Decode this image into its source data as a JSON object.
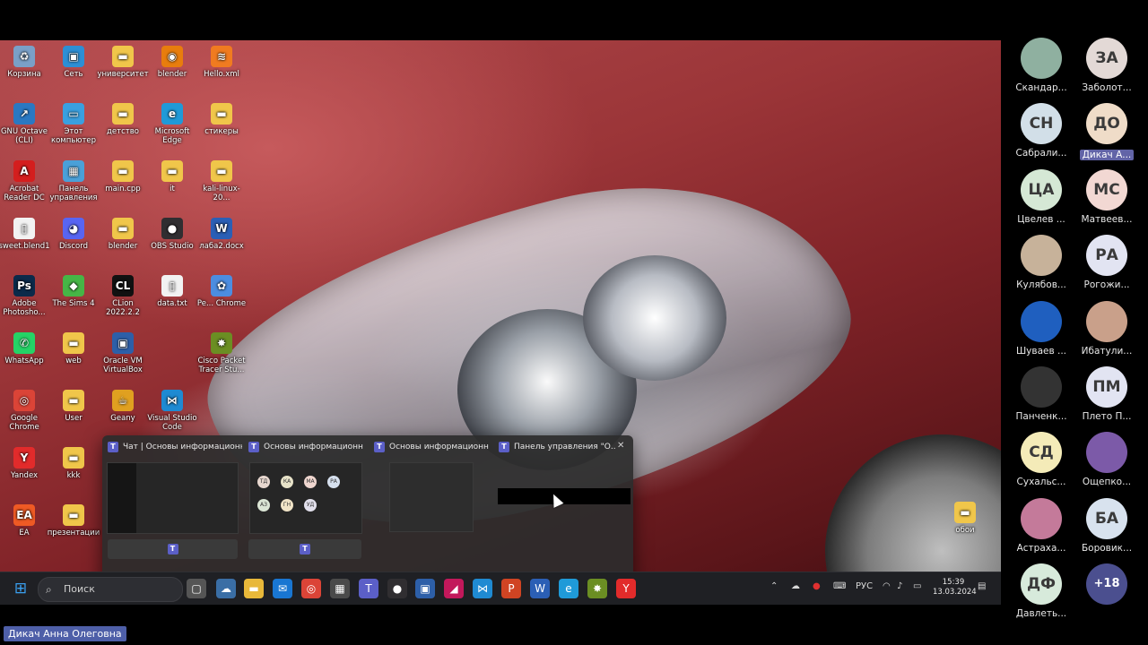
{
  "desktop": {
    "icons": [
      {
        "label": "Корзина",
        "glyph": "♻",
        "color": "#7aa0c8"
      },
      {
        "label": "Сеть",
        "glyph": "▣",
        "color": "#2d8fd5"
      },
      {
        "label": "университет",
        "glyph": "▬",
        "color": "#f0c64a"
      },
      {
        "label": "blender",
        "glyph": "◉",
        "color": "#e87d0d"
      },
      {
        "label": "Hello.xml",
        "glyph": "≋",
        "color": "#f07b20"
      },
      {
        "label": "GNU Octave\n(CLI)",
        "glyph": "↗",
        "color": "#2a78c2"
      },
      {
        "label": "Этот\nкомпьютер",
        "glyph": "▭",
        "color": "#3aa0e0"
      },
      {
        "label": "детство",
        "glyph": "▬",
        "color": "#f0c64a"
      },
      {
        "label": "Microsoft\nEdge",
        "glyph": "e",
        "color": "#1f9ad8"
      },
      {
        "label": "стикеры",
        "glyph": "▬",
        "color": "#f0c64a"
      },
      {
        "label": "Acrobat\nReader DC",
        "glyph": "A",
        "color": "#d41e1e"
      },
      {
        "label": "Панель\nуправления",
        "glyph": "▦",
        "color": "#4aa0d8"
      },
      {
        "label": "main.cpp",
        "glyph": "▬",
        "color": "#f0c64a"
      },
      {
        "label": "it",
        "glyph": "▬",
        "color": "#f0c64a"
      },
      {
        "label": "kali-linux-20...",
        "glyph": "▬",
        "color": "#f0c64a"
      },
      {
        "label": "sweet.blend1",
        "glyph": "▯",
        "color": "#f2f2f2"
      },
      {
        "label": "Discord",
        "glyph": "◕",
        "color": "#5865f2"
      },
      {
        "label": "blender",
        "glyph": "▬",
        "color": "#f0c64a"
      },
      {
        "label": "OBS Studio",
        "glyph": "●",
        "color": "#302e31"
      },
      {
        "label": "лаба2.docx",
        "glyph": "W",
        "color": "#2b5fb5"
      },
      {
        "label": "Adobe\nPhotosho...",
        "glyph": "Ps",
        "color": "#0b2a4a"
      },
      {
        "label": "The Sims 4",
        "glyph": "◆",
        "color": "#46b546"
      },
      {
        "label": "CLion\n2022.2.2",
        "glyph": "CL",
        "color": "#111111"
      },
      {
        "label": "data.txt",
        "glyph": "▯",
        "color": "#f2f2f2"
      },
      {
        "label": "Pe... Chrome",
        "glyph": "✿",
        "color": "#4c8de0"
      },
      {
        "label": "WhatsApp",
        "glyph": "✆",
        "color": "#25d366"
      },
      {
        "label": "web",
        "glyph": "▬",
        "color": "#f0c64a"
      },
      {
        "label": "Oracle VM\nVirtualBox",
        "glyph": "▣",
        "color": "#2d5fa8"
      },
      {
        "label": "Cisco Packet\nTracer Stu...",
        "glyph": "✸",
        "color": "#6b8e23"
      },
      {
        "label": "Google\nChrome",
        "glyph": "◎",
        "color": "#db4437"
      },
      {
        "label": "User",
        "glyph": "▬",
        "color": "#f0c64a"
      },
      {
        "label": "Geany",
        "glyph": "☕",
        "color": "#e0a020"
      },
      {
        "label": "Visual Studio\nCode",
        "glyph": "⋈",
        "color": "#1f8ad2"
      },
      {
        "label": "Yandex",
        "glyph": "Y",
        "color": "#e22b2b"
      },
      {
        "label": "kkk",
        "glyph": "▬",
        "color": "#f0c64a"
      },
      {
        "label": "EA",
        "glyph": "EA",
        "color": "#ef5a24"
      },
      {
        "label": "презентации",
        "glyph": "▬",
        "color": "#f0c64a"
      },
      {
        "label": "обои",
        "glyph": "▬",
        "color": "#f0c64a"
      }
    ]
  },
  "switcher": {
    "windows": [
      {
        "title": "Чат | Основы информационно..."
      },
      {
        "title": "Основы информационно..."
      },
      {
        "title": "Основы информационно..."
      },
      {
        "title": "Панель управления \"О..."
      }
    ],
    "close_glyph": "✕",
    "thumb_avatars": [
      "ТД",
      "КА",
      "МА",
      "РА",
      "АЗ",
      "ГН",
      "УД"
    ]
  },
  "taskbar": {
    "search_label": "Поиск",
    "language": "РУС",
    "time": "15:39",
    "date": "13.03.2024",
    "apps": [
      {
        "name": "task-view-icon",
        "glyph": "▢",
        "color": "#555"
      },
      {
        "name": "widgets-icon",
        "glyph": "☁",
        "color": "#3a6ea5"
      },
      {
        "name": "file-explorer-icon",
        "glyph": "▬",
        "color": "#e8b83a"
      },
      {
        "name": "mail-icon",
        "glyph": "✉",
        "color": "#1976d2"
      },
      {
        "name": "chrome-icon",
        "glyph": "◎",
        "color": "#db4437"
      },
      {
        "name": "calculator-icon",
        "glyph": "▦",
        "color": "#4a4a4a"
      },
      {
        "name": "teams-icon",
        "glyph": "T",
        "color": "#5b5fc7"
      },
      {
        "name": "obs-icon",
        "glyph": "●",
        "color": "#302e31"
      },
      {
        "name": "virtualbox-icon",
        "glyph": "▣",
        "color": "#2d5fa8"
      },
      {
        "name": "jetbrains-icon",
        "glyph": "◢",
        "color": "#c2185b"
      },
      {
        "name": "vscode-icon",
        "glyph": "⋈",
        "color": "#1f8ad2"
      },
      {
        "name": "powerpoint-icon",
        "glyph": "P",
        "color": "#d04423"
      },
      {
        "name": "word-icon",
        "glyph": "W",
        "color": "#2b5fb5"
      },
      {
        "name": "edge-icon",
        "glyph": "e",
        "color": "#1f9ad8"
      },
      {
        "name": "packet-tracer-icon",
        "glyph": "✸",
        "color": "#6b8e23"
      },
      {
        "name": "yandex-icon",
        "glyph": "Y",
        "color": "#e22b2b"
      }
    ]
  },
  "participants": [
    {
      "name": "Скандар...",
      "initials": "",
      "bg": "#8fb0a0"
    },
    {
      "name": "Заболот...",
      "initials": "ЗА",
      "bg": "#e3d9d6"
    },
    {
      "name": "Сабрали...",
      "initials": "СН",
      "bg": "#d2dfe8"
    },
    {
      "name": "Дикач А...",
      "initials": "ДО",
      "bg": "#efdcc8",
      "highlight": true
    },
    {
      "name": "Цвелев ...",
      "initials": "ЦА",
      "bg": "#d5e8d5"
    },
    {
      "name": "Матвеев...",
      "initials": "МС",
      "bg": "#f2d8d3"
    },
    {
      "name": "Кулябов...",
      "initials": "",
      "bg": "#c7b29a"
    },
    {
      "name": "Рогожи...",
      "initials": "РА",
      "bg": "#e2e4f2"
    },
    {
      "name": "Шуваев ...",
      "initials": "",
      "bg": "#1f5fbf"
    },
    {
      "name": "Ибатули...",
      "initials": "",
      "bg": "#c9a08a"
    },
    {
      "name": "Панченк...",
      "initials": "",
      "bg": "#333333"
    },
    {
      "name": "Плето П...",
      "initials": "ПМ",
      "bg": "#e2e4f2"
    },
    {
      "name": "Сухальс...",
      "initials": "СД",
      "bg": "#f4ebb8"
    },
    {
      "name": "Ощепко...",
      "initials": "",
      "bg": "#7c5aa8"
    },
    {
      "name": "Астраха...",
      "initials": "",
      "bg": "#c47a9a"
    },
    {
      "name": "Боровик...",
      "initials": "БА",
      "bg": "#d8e2ee"
    },
    {
      "name": "Давлеть...",
      "initials": "ДФ",
      "bg": "#d7eadb"
    },
    {
      "name": "",
      "initials": "+18",
      "bg": "#4b4f8f",
      "more": true
    }
  ],
  "presenter": {
    "name": "Дикач Анна Олеговна"
  }
}
